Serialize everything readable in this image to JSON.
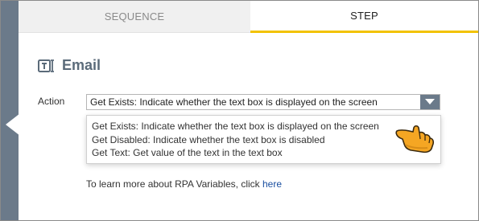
{
  "tabs": {
    "sequence_label": "SEQUENCE",
    "step_label": "STEP"
  },
  "header": {
    "icon": "text-field-icon",
    "title": "Email"
  },
  "action": {
    "label": "Action",
    "selected_value": "Get Exists: Indicate whether the text box is displayed on the screen",
    "options": [
      "Get Exists: Indicate whether the text box is displayed on the screen",
      "Get Disabled: Indicate whether the text box is disabled",
      "Get Text: Get value of the text in the text box"
    ]
  },
  "hint": {
    "text": "To learn more about RPA Variables, click ",
    "link_text": "here"
  },
  "colors": {
    "accent": "#f2c200",
    "sidebar": "#6b7a8a",
    "link": "#1a4fa0"
  }
}
